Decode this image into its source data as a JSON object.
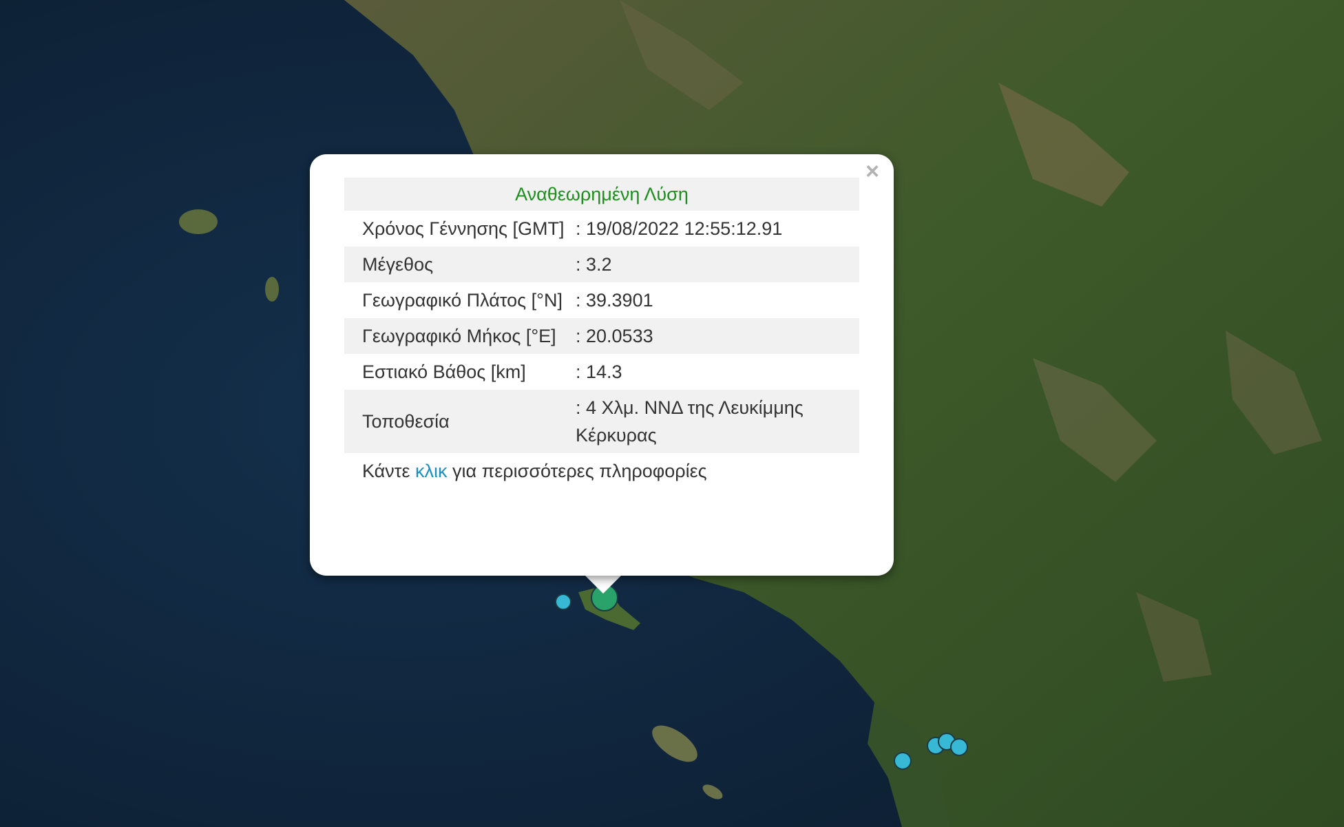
{
  "popup": {
    "close_symbol": "×",
    "title": "Αναθεωρημένη Λύση",
    "rows": [
      {
        "label": "Χρόνος Γέννησης [GMT]",
        "value": ": 19/08/2022 12:55:12.91"
      },
      {
        "label": "Μέγεθος",
        "value": ": 3.2"
      },
      {
        "label": "Γεωγραφικό Πλάτος [°N]",
        "value": ": 39.3901"
      },
      {
        "label": "Γεωγραφικό Μήκος [°E]",
        "value": ": 20.0533"
      },
      {
        "label": "Εστιακό Βάθος [km]",
        "value": ": 14.3"
      },
      {
        "label": "Τοποθεσία",
        "value": ": 4 Χλμ. ΝΝΔ της Λευκίμμης Κέρκυρας"
      }
    ],
    "footer_prefix": "Κάντε",
    "footer_link": "κλικ",
    "footer_suffix": "για περισσότερες πληροφορίες"
  },
  "colors": {
    "title_green": "#1e8f1e",
    "link_blue": "#1b8fc4",
    "marker_selected": "#2aa36a",
    "marker_other": "#37b8d4",
    "sea": "#0f2238"
  }
}
